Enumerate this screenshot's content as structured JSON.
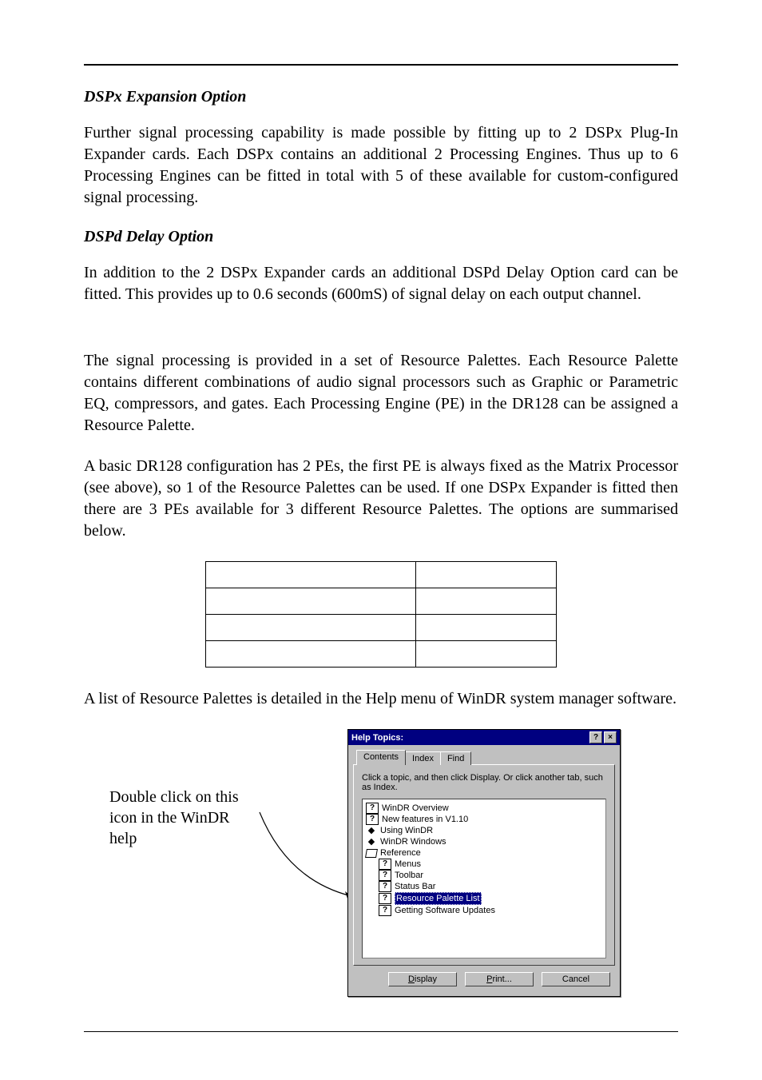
{
  "headings": {
    "dspx": "DSPx Expansion Option",
    "dspd": "DSPd Delay Option"
  },
  "paragraphs": {
    "p1": "Further signal processing capability is made possible by fitting up to 2 DSPx Plug-In Expander cards. Each DSPx contains an additional 2 Processing Engines. Thus up to 6 Processing Engines can be fitted in total with 5 of these available for custom-configured signal processing.",
    "p2": "In addition to the 2 DSPx Expander cards an additional DSPd Delay Option card can be fitted. This provides up to 0.6 seconds (600mS) of signal delay on each output channel.",
    "p3": "The signal processing is provided in a set of Resource Palettes. Each Resource Palette contains different combinations of audio signal processors such as Graphic or Parametric EQ, compressors, and gates. Each Processing Engine (PE) in the DR128 can be assigned a Resource Palette.",
    "p4": "A basic DR128 configuration has 2 PEs, the first PE is always fixed as the Matrix Processor (see above), so 1 of the Resource Palettes can be used. If one DSPx Expander is fitted then there are 3 PEs available for 3 different Resource Palettes. The options are summarised below.",
    "p5": "A list of Resource Palettes is detailed in the Help menu of WinDR system manager software."
  },
  "callout": "Double click on this icon in the WinDR help",
  "help_window": {
    "title": "Help Topics:",
    "titlebar_help": "?",
    "titlebar_close": "×",
    "tabs": {
      "contents": "Contents",
      "index": "Index",
      "find": "Find"
    },
    "instruction": "Click a topic, and then click Display. Or click another tab, such as Index.",
    "tree": {
      "i0": "WinDR Overview",
      "i1": "New features in V1.10",
      "i2": "Using WinDR",
      "i3": "WinDR Windows",
      "i4": "Reference",
      "i5": "Menus",
      "i6": "Toolbar",
      "i7": "Status Bar",
      "i8": "Resource Palette List",
      "i9": "Getting Software Updates"
    },
    "buttons": {
      "display_u": "D",
      "display_r": "isplay",
      "print_u": "P",
      "print_r": "rint...",
      "cancel": "Cancel"
    }
  }
}
